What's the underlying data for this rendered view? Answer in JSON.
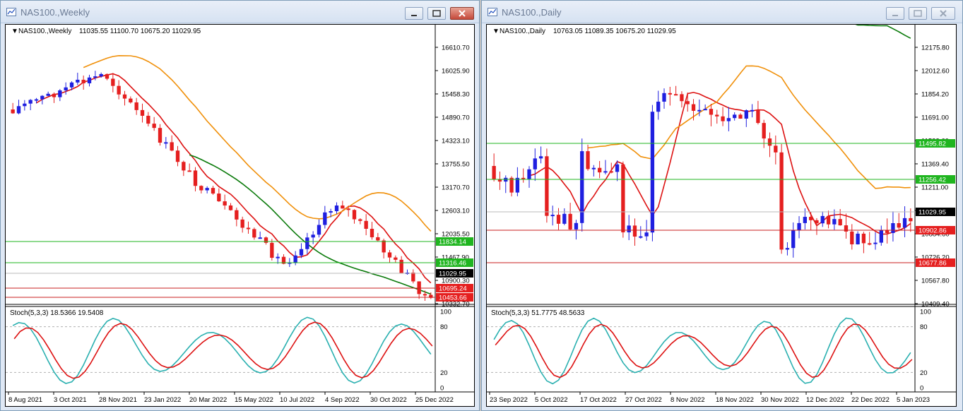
{
  "left": {
    "title": "NAS100.,Weekly",
    "info_label": "NAS100.,Weekly",
    "info_values": "11035.55 11100.70 10675.20 11029.95",
    "price_ticks": [
      "16610.70",
      "16025.90",
      "15458.30",
      "14890.70",
      "14323.10",
      "13755.50",
      "13170.70",
      "12603.10",
      "12035.50",
      "11467.90",
      "10900.30",
      "10332.70"
    ],
    "tags": [
      {
        "text": "11834.14",
        "color": "#1fb51f"
      },
      {
        "text": "11316.46",
        "color": "#1fb51f"
      },
      {
        "text": "11029.95",
        "color": "#000000"
      },
      {
        "text": "10695.24",
        "color": "#e51f1f"
      },
      {
        "text": "10453.66",
        "color": "#e51f1f"
      }
    ],
    "stoch_label": "Stoch(5,3,3) 18.5366 19.5408",
    "stoch_ticks": [
      "100",
      "80",
      "20",
      "0"
    ],
    "date_labels": [
      "8 Aug 2021",
      "3 Oct 2021",
      "28 Nov 2021",
      "23 Jan 2022",
      "20 Mar 2022",
      "15 May 2022",
      "10 Jul 2022",
      "4 Sep 2022",
      "30 Oct 2022",
      "25 Dec 2022"
    ]
  },
  "right": {
    "title": "NAS100.,Daily",
    "info_label": "NAS100.,Daily",
    "info_values": "10763.05 11089.35 10675.20 11029.95",
    "price_ticks": [
      "12175.80",
      "12012.60",
      "11854.20",
      "11691.00",
      "11532.60",
      "11369.40",
      "11211.00",
      "11047.80",
      "10884.60",
      "10726.20",
      "10567.80",
      "10409.40"
    ],
    "tags": [
      {
        "text": "11495.82",
        "color": "#1fb51f"
      },
      {
        "text": "11256.42",
        "color": "#1fb51f"
      },
      {
        "text": "11029.95",
        "color": "#000000"
      },
      {
        "text": "10902.86",
        "color": "#e51f1f"
      },
      {
        "text": "10677.86",
        "color": "#e51f1f"
      }
    ],
    "stoch_label": "Stoch(5,3,3) 51.7775 48.5633",
    "stoch_ticks": [
      "100",
      "80",
      "20",
      "0"
    ],
    "date_labels": [
      "23 Sep 2022",
      "5 Oct 2022",
      "17 Oct 2022",
      "27 Oct 2022",
      "8 Nov 2022",
      "18 Nov 2022",
      "30 Nov 2022",
      "12 Dec 2022",
      "22 Dec 2022",
      "5 Jan 2023"
    ]
  },
  "colors": {
    "bull": "#1f1fe0",
    "bear": "#e51f1f",
    "ma_fast": "#dd1111",
    "ma_mid": "#f0900a",
    "ma_slow": "#0a7a0a",
    "stoch_main": "#2ab0b0",
    "stoch_signal": "#dd1111",
    "hline_green": "#1fb51f",
    "hline_red": "#c81f1f"
  },
  "icons": {
    "window": "chart-window-icon",
    "minimize": "minimize-icon",
    "maximize": "maximize-icon",
    "close": "close-icon"
  }
}
